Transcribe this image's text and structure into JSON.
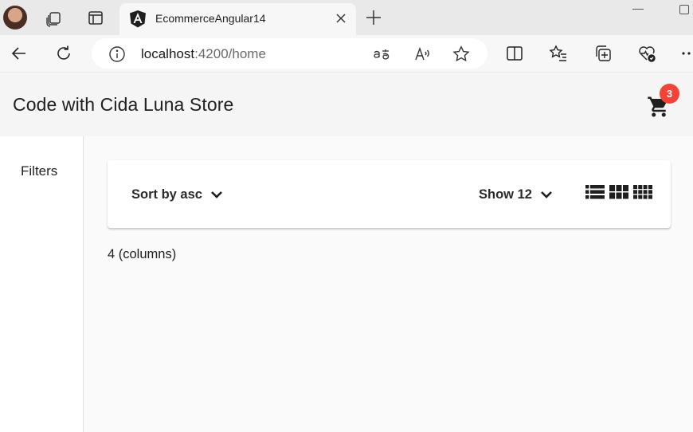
{
  "browser": {
    "tab_title": "EcommerceAngular14",
    "url_host": "localhost",
    "url_rest": ":4200/home",
    "icons": [
      "avatar",
      "collections-icon",
      "tab-actions-icon",
      "angular-logo-icon",
      "close-icon",
      "new-tab-icon",
      "back-icon",
      "refresh-icon",
      "info-icon",
      "translate-icon",
      "read-aloud-icon",
      "favorite-star-icon",
      "split-screen-icon",
      "favorites-icon",
      "collections-add-icon",
      "browser-health-icon",
      "more-icon"
    ]
  },
  "header": {
    "title": "Code with Cida Luna Store",
    "cart_count": "3",
    "badge_color": "#f44336"
  },
  "sidebar": {
    "filters_label": "Filters"
  },
  "toolbar": {
    "sort_label": "Sort by asc",
    "show_label": "Show 12",
    "view_options": [
      "list-view-icon",
      "three-column-icon",
      "four-column-icon"
    ]
  },
  "main": {
    "columns_text": "4 (columns)"
  }
}
